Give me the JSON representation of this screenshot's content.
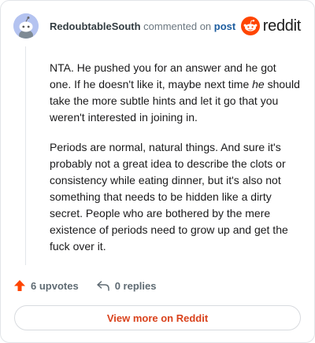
{
  "comment": {
    "username": "RedoubtableSouth",
    "action_text": "commented on",
    "post_link_label": "post",
    "paragraphs": [
      {
        "before": "NTA. He pushed you for an answer and he got one. If he doesn't like it, maybe next time ",
        "emphasis": "he",
        "after": " should take the more subtle hints and let it go that you weren't interested in joining in."
      },
      {
        "text": "Periods are normal, natural things. And sure it's probably not a great idea to describe the clots or consistency while eating dinner, but it's also not something that needs to be hidden like a dirty secret. People who are bothered by the mere existence of periods need to grow up and get the fuck over it."
      }
    ]
  },
  "brand": {
    "name": "reddit",
    "icon": "reddit-snoo-icon",
    "color": "#ff4500"
  },
  "footer": {
    "upvotes_label": "6 upvotes",
    "replies_label": "0 replies",
    "upvote_icon": "upvote-arrow-icon",
    "reply_icon": "reply-arrow-icon",
    "upvote_color": "#ff4500"
  },
  "cta": {
    "label": "View more on Reddit",
    "color": "#d9421c"
  }
}
